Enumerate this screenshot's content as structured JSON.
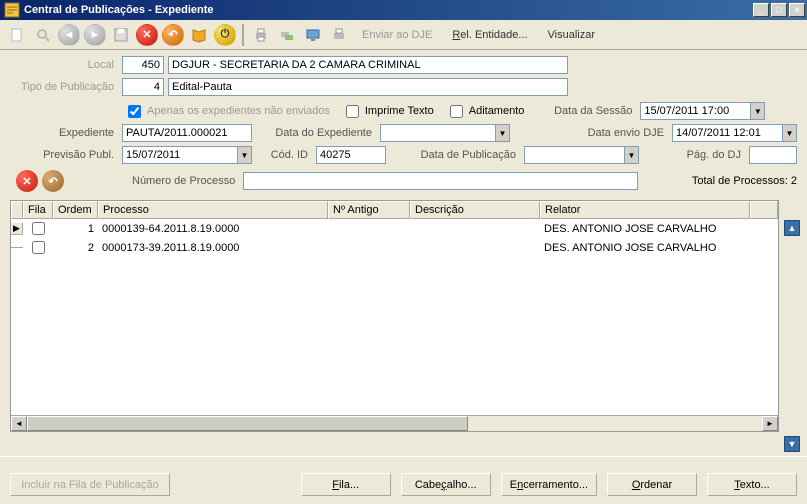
{
  "window": {
    "title": "Central de Publicações - Expediente"
  },
  "toolbar": {
    "enviar": "Enviar ao DJE",
    "rel_entidade": "Rel. Entidade...",
    "visualizar": "Visualizar"
  },
  "form": {
    "local_label": "Local",
    "local_code": "450",
    "local_desc": "DGJUR - SECRETARIA DA 2 CAMARA CRIMINAL",
    "tipo_pub_label": "Tipo de Publicação",
    "tipo_pub_code": "4",
    "tipo_pub_desc": "Edital-Pauta",
    "apenas_nao_enviados": "Apenas os expedientes não enviados",
    "imprime_texto": "Imprime Texto",
    "aditamento": "Aditamento",
    "data_sessao_label": "Data da Sessão",
    "data_sessao": "15/07/2011 17:00",
    "expediente_label": "Expediente",
    "expediente": "PAUTA/2011.000021",
    "data_expediente_label": "Data do Expediente",
    "data_expediente": "",
    "data_envio_dje_label": "Data envio DJE",
    "data_envio_dje": "14/07/2011 12:01",
    "previsao_publ_label": "Previsão Publ.",
    "previsao_publ": "15/07/2011",
    "cod_id_label": "Cód. ID",
    "cod_id": "40275",
    "data_publicacao_label": "Data de Publicação",
    "data_publicacao": "",
    "pag_dj_label": "Pág. do DJ",
    "pag_dj": "",
    "numero_processo_label": "Número de Processo",
    "total_processos_label": "Total de Processos: 2"
  },
  "grid": {
    "headers": {
      "fila": "Fila",
      "ordem": "Ordem",
      "processo": "Processo",
      "n_antigo": "Nº Antigo",
      "descricao": "Descrição",
      "relator": "Relator"
    },
    "rows": [
      {
        "ordem": "1",
        "processo": "0000139-64.2011.8.19.0000",
        "n_antigo": "",
        "descricao": "",
        "relator": "DES. ANTONIO JOSE CARVALHO"
      },
      {
        "ordem": "2",
        "processo": "0000173-39.2011.8.19.0000",
        "n_antigo": "",
        "descricao": "",
        "relator": "DES. ANTONIO JOSE CARVALHO"
      }
    ]
  },
  "buttons": {
    "incluir": "Incluir na Fila de Publicação",
    "fila": "Fila...",
    "cabecalho": "Cabeçalho...",
    "encerramento": "Encerramento...",
    "ordenar": "Ordenar",
    "texto": "Texto..."
  }
}
